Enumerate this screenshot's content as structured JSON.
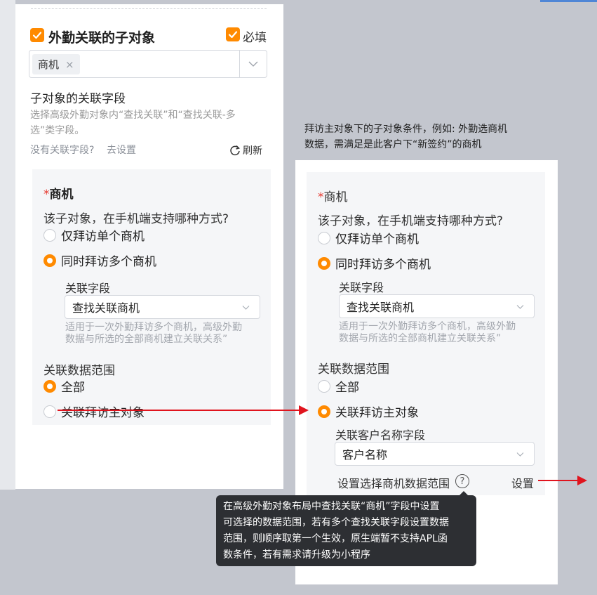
{
  "left": {
    "main_checkbox_label": "外勤关联的子对象",
    "required_label": "必填",
    "selected_tags": [
      {
        "label": "商机",
        "remove": "×"
      }
    ],
    "sub_field_title": "子对象的关联字段",
    "sub_field_hint_line1": "选择高级外勤对象内“查找关联”和“查找关联-多",
    "sub_field_hint_line2": "选”类字段。",
    "no_field_text": "没有关联字段?",
    "go_setup_link": "去设置",
    "refresh_label": "刷新",
    "card": {
      "required_mark": "*",
      "heading": "商机",
      "question": "该子对象，在手机端支持哪种方式?",
      "option_single": "仅拜访单个商机",
      "option_multi": "同时拜访多个商机",
      "related_field_label": "关联字段",
      "related_field_value": "查找关联商机",
      "related_hint_line1": "适用于一次外勤拜访多个商机，高级外勤",
      "related_hint_line2": "数据与所选的全部商机建立关联关系”",
      "range_label": "关联数据范围",
      "range_all": "全部",
      "range_main": "关联拜访主对象"
    }
  },
  "annotation": {
    "line1": "拜访主对象下的子对象条件，例如: 外勤选商机",
    "line2": "数据，需满足是此客户下“新签约”的商机"
  },
  "right": {
    "card": {
      "required_mark": "*",
      "heading": "商机",
      "question": "该子对象，在手机端支持哪种方式?",
      "option_single": "仅拜访单个商机",
      "option_multi": "同时拜访多个商机",
      "related_field_label": "关联字段",
      "related_field_value": "查找关联商机",
      "related_hint_line1": "适用于一次外勤拜访多个商机，高级外勤",
      "related_hint_line2": "数据与所选的全部商机建立关联关系”",
      "range_label": "关联数据范围",
      "range_all": "全部",
      "range_main": "关联拜访主对象",
      "customer_field_label": "关联客户名称字段",
      "customer_field_value": "客户名称",
      "set_range_label": "设置选择商机数据范围",
      "help_glyph": "?",
      "set_link": "设置"
    }
  },
  "tooltip": {
    "line1": "在高级外勤对象布局中查找关联“商机”字段中设置",
    "line2": "可选择的数据范围，若有多个查找关联字段设置数据",
    "line3": "范围，则顺序取第一个生效，原生端暂不支持APL函",
    "line4": "数条件，若有需求请升级为小程序"
  },
  "colors": {
    "accent": "#ff8a00",
    "link": "#1a6fe0",
    "arrow": "#e0141e",
    "required": "#e6392f"
  }
}
